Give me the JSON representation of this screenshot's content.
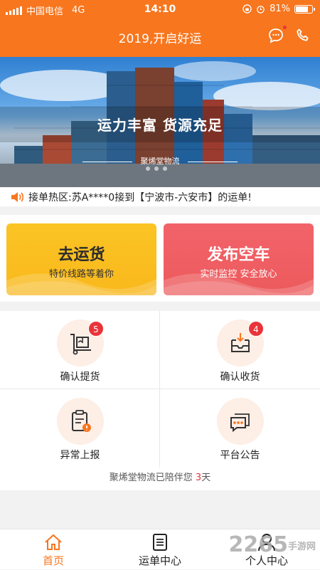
{
  "status_bar": {
    "carrier": "中国电信",
    "network": "4G",
    "time": "14:10",
    "battery": "81%",
    "battery_level": 0.81
  },
  "header": {
    "title": "2019,开启好运"
  },
  "banner": {
    "headline": "运力丰富  货源充足",
    "brand": "聚烯堂物流"
  },
  "notice": {
    "text": "接单热区:苏A****0接到【宁波市-六安市】的运单!"
  },
  "cards": [
    {
      "title": "去运货",
      "subtitle": "特价线路等着你"
    },
    {
      "title": "发布空车",
      "subtitle": "实时监控 安全放心"
    }
  ],
  "grid": [
    {
      "label": "确认提货",
      "icon": "pickup-box-icon",
      "badge": "5"
    },
    {
      "label": "确认收货",
      "icon": "receive-tray-icon",
      "badge": "4"
    },
    {
      "label": "异常上报",
      "icon": "exception-report-icon"
    },
    {
      "label": "平台公告",
      "icon": "announcement-icon"
    }
  ],
  "footer": {
    "prefix": "聚烯堂物流已陪伴您 ",
    "days": "3",
    "suffix": "天"
  },
  "tabs": [
    {
      "label": "首页",
      "icon": "home-icon"
    },
    {
      "label": "运单中心",
      "icon": "waybill-icon"
    },
    {
      "label": "个人中心",
      "icon": "person-icon"
    }
  ],
  "watermark": {
    "text": "2265",
    "suffix": "手游网"
  },
  "colors": {
    "primary": "#f7761e",
    "card_left": "#fbc02d",
    "card_right": "#ee5a5e",
    "badge": "#e9333a"
  }
}
